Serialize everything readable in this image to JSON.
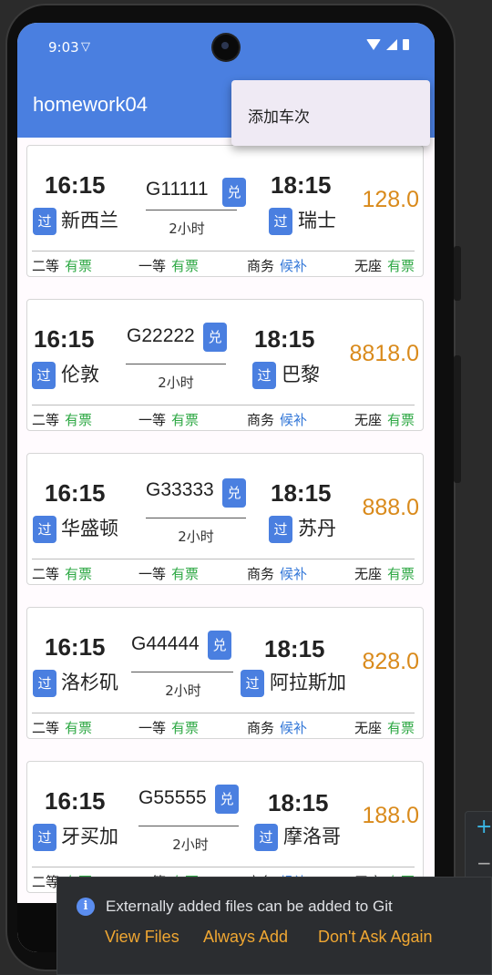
{
  "status": {
    "time": "9:03"
  },
  "app": {
    "title": "homework04",
    "menu_item": "添加车次"
  },
  "trains": [
    {
      "dep_time": "16:15",
      "code": "G11111",
      "badge": "兑",
      "arr_time": "18:15",
      "from_badge": "过",
      "from": "新西兰",
      "to_badge": "过",
      "to": "瑞士",
      "duration": "2小时",
      "price": "128.0",
      "seats": [
        {
          "cls": "二等",
          "st": "有票"
        },
        {
          "cls": "一等",
          "st": "有票"
        },
        {
          "cls": "商务",
          "st": "候补"
        },
        {
          "cls": "无座",
          "st": "有票"
        }
      ]
    },
    {
      "dep_time": "16:15",
      "code": "G22222",
      "badge": "兑",
      "arr_time": "18:15",
      "from_badge": "过",
      "from": "伦敦",
      "to_badge": "过",
      "to": "巴黎",
      "duration": "2小时",
      "price": "8818.0",
      "seats": [
        {
          "cls": "二等",
          "st": "有票"
        },
        {
          "cls": "一等",
          "st": "有票"
        },
        {
          "cls": "商务",
          "st": "候补"
        },
        {
          "cls": "无座",
          "st": "有票"
        }
      ]
    },
    {
      "dep_time": "16:15",
      "code": "G33333",
      "badge": "兑",
      "arr_time": "18:15",
      "from_badge": "过",
      "from": "华盛顿",
      "to_badge": "过",
      "to": "苏丹",
      "duration": "2小时",
      "price": "888.0",
      "seats": [
        {
          "cls": "二等",
          "st": "有票"
        },
        {
          "cls": "一等",
          "st": "有票"
        },
        {
          "cls": "商务",
          "st": "候补"
        },
        {
          "cls": "无座",
          "st": "有票"
        }
      ]
    },
    {
      "dep_time": "16:15",
      "code": "G44444",
      "badge": "兑",
      "arr_time": "18:15",
      "from_badge": "过",
      "from": "洛杉矶",
      "to_badge": "过",
      "to": "阿拉斯加",
      "duration": "2小时",
      "price": "828.0",
      "seats": [
        {
          "cls": "二等",
          "st": "有票"
        },
        {
          "cls": "一等",
          "st": "有票"
        },
        {
          "cls": "商务",
          "st": "候补"
        },
        {
          "cls": "无座",
          "st": "有票"
        }
      ]
    },
    {
      "dep_time": "16:15",
      "code": "G55555",
      "badge": "兑",
      "arr_time": "18:15",
      "from_badge": "过",
      "from": "牙买加",
      "to_badge": "过",
      "to": "摩洛哥",
      "duration": "2小时",
      "price": "188.0",
      "seats": [
        {
          "cls": "二等",
          "st": "有票"
        },
        {
          "cls": "一等",
          "st": "有票"
        },
        {
          "cls": "商务",
          "st": "候补"
        },
        {
          "cls": "无座",
          "st": "有票"
        }
      ]
    }
  ],
  "notification": {
    "icon": "info-icon",
    "text": "Externally added files can be added to Git",
    "actions": [
      "View Files",
      "Always Add",
      "Don't Ask Again"
    ]
  },
  "edge": {
    "plus": "+",
    "minus": "−"
  },
  "colors": {
    "primary": "#4a7fe0",
    "price": "#d98a1b",
    "available": "#2ea844",
    "waitlist": "#3478d8",
    "notif_action": "#f0a732"
  }
}
